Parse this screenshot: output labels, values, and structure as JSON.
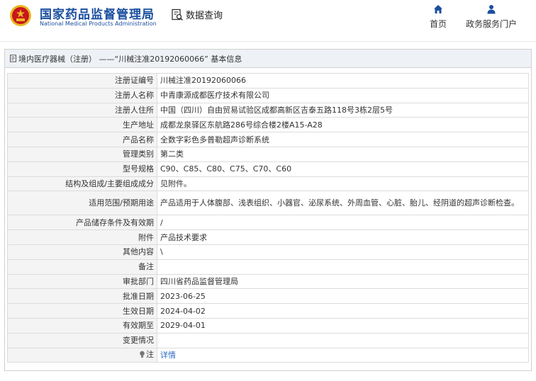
{
  "header": {
    "brand_cn": "国家药品监督管理局",
    "brand_en": "National Medical Products Administration",
    "search_label": "数据查询",
    "nav": [
      {
        "label": "首页",
        "icon": "home-icon"
      },
      {
        "label": "政务服务门户",
        "icon": "user-icon"
      }
    ],
    "colors": {
      "brand": "#1b4fa0",
      "emblem_red": "#c8161d",
      "emblem_gold": "#e8b923"
    }
  },
  "panel": {
    "title": "境内医疗器械（注册） ——“川械注准20192060066” 基本信息"
  },
  "rows": [
    {
      "label": "注册证编号",
      "value": "川械注准20192060066"
    },
    {
      "label": "注册人名称",
      "value": "中青康源成都医疗技术有限公司"
    },
    {
      "label": "注册人住所",
      "value": "中国（四川）自由贸易试验区成都高新区吉泰五路118号3栋2层5号"
    },
    {
      "label": "生产地址",
      "value": "成都龙泉驿区东航路286号综合楼2楼A15-A28"
    },
    {
      "label": "产品名称",
      "value": "全数字彩色多普勒超声诊断系统"
    },
    {
      "label": "管理类别",
      "value": "第二类"
    },
    {
      "label": "型号规格",
      "value": "C90、C85、C80、C75、C70、C60"
    },
    {
      "label": "结构及组成/主要组成成分",
      "value": "见附件。"
    },
    {
      "label": "适用范围/预期用途",
      "value": "产品适用于人体腹部、浅表组织、小器官、泌尿系统、外周血管、心脏、胎儿、经阴道的超声诊断检查。"
    },
    {
      "label": "产品储存条件及有效期",
      "value": "/"
    },
    {
      "label": "附件",
      "value": "产品技术要求"
    },
    {
      "label": "其他内容",
      "value": "\\"
    },
    {
      "label": "备注",
      "value": ""
    },
    {
      "label": "审批部门",
      "value": "四川省药品监督管理局"
    },
    {
      "label": "批准日期",
      "value": "2023-06-25"
    },
    {
      "label": "生效日期",
      "value": "2024-04-02"
    },
    {
      "label": "有效期至",
      "value": "2029-04-01"
    },
    {
      "label": "变更情况",
      "value": ""
    },
    {
      "label": "注",
      "value": "详情",
      "icon": "bulb-icon"
    }
  ]
}
